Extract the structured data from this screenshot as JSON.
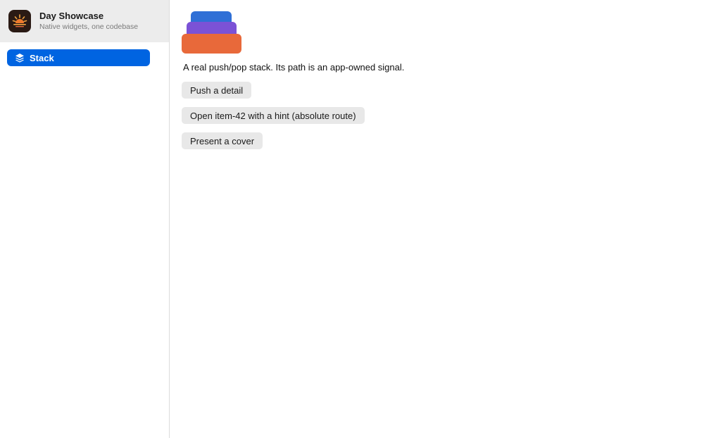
{
  "app": {
    "title": "Day Showcase",
    "subtitle": "Native widgets, one codebase",
    "icon": "sunrise-icon"
  },
  "sidebar": {
    "items": [
      {
        "label": "Stack",
        "icon": "stack-layers-icon",
        "selected": true
      }
    ]
  },
  "main": {
    "hero_icon": "stacked-cards-icon",
    "description": "A real push/pop stack. Its path is an app-owned signal.",
    "buttons": {
      "push": "Push a detail",
      "open": "Open item-42 with a hint (absolute route)",
      "cover": "Present a cover"
    }
  },
  "colors": {
    "accent": "#0064e1",
    "sidebar_header_bg": "#ececec",
    "button_bg": "#e8e8e8",
    "stack_top": "#2f6fd6",
    "stack_middle": "#7b52d6",
    "stack_bottom": "#e8693a"
  }
}
